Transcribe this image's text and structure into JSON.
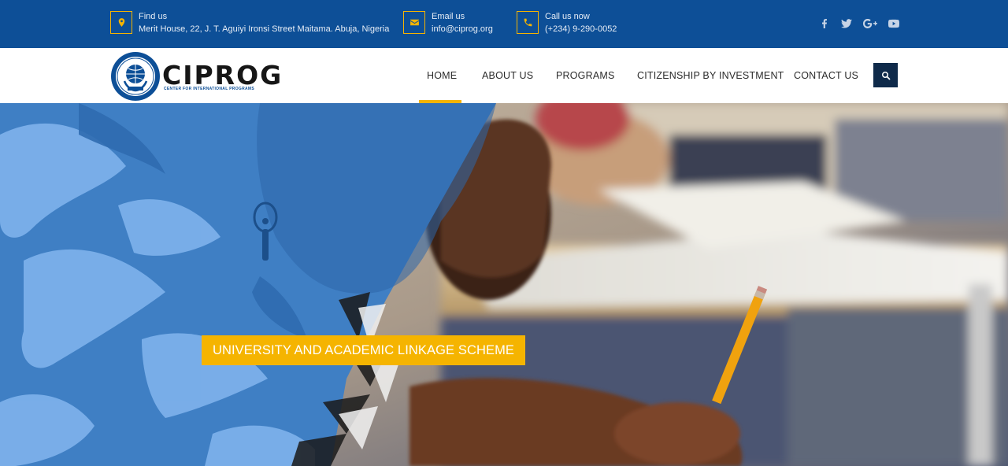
{
  "topbar": {
    "find": {
      "label": "Find us",
      "value": "Merit House, 22, J. T. Aguiyi Ironsi Street Maitama. Abuja, Nigeria",
      "icon": "map-marker-icon"
    },
    "email": {
      "label": "Email us",
      "value": "info@ciprog.org",
      "icon": "envelope-icon"
    },
    "call": {
      "label": "Call us now",
      "value": "(+234) 9-290-0052",
      "icon": "phone-icon"
    },
    "social": [
      "facebook-icon",
      "twitter-icon",
      "google-plus-icon",
      "youtube-icon"
    ]
  },
  "brand": {
    "name": "CIPROG",
    "tagline": "CENTER FOR INTERNATIONAL PROGRAMS"
  },
  "nav": {
    "items": [
      "HOME",
      "ABOUT US",
      "PROGRAMS",
      "CITIZENSHIP BY INVESTMENT",
      "CONTACT US"
    ],
    "active": "HOME",
    "search_icon": "search-icon"
  },
  "hero": {
    "tag": "UNIVERSITY AND ACADEMIC LINKAGE SCHEME"
  },
  "colors": {
    "primary": "#0d4f97",
    "accent": "#f5b400",
    "dark": "#0f2a4a"
  }
}
